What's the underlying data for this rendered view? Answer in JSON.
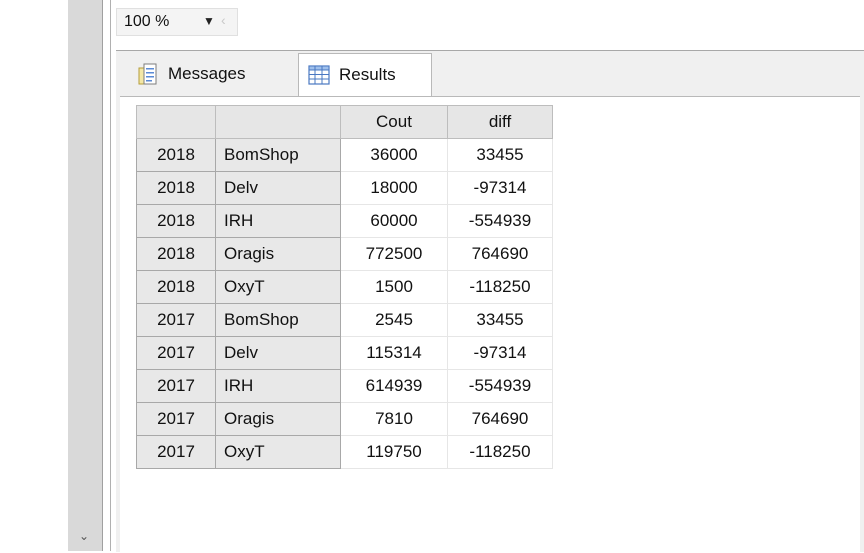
{
  "zoom": {
    "value": "100 %"
  },
  "tabs": [
    {
      "label": "Messages",
      "icon": "messages-icon"
    },
    {
      "label": "Results",
      "icon": "results-grid-icon"
    }
  ],
  "grid": {
    "headers": [
      "",
      "",
      "Cout",
      "diff"
    ],
    "rows": [
      {
        "year": "2018",
        "name": "BomShop",
        "cout": "36000",
        "diff": "33455"
      },
      {
        "year": "2018",
        "name": "Delv",
        "cout": "18000",
        "diff": "-97314"
      },
      {
        "year": "2018",
        "name": "IRH",
        "cout": "60000",
        "diff": "-554939"
      },
      {
        "year": "2018",
        "name": "Oragis",
        "cout": "772500",
        "diff": "764690"
      },
      {
        "year": "2018",
        "name": "OxyT",
        "cout": "1500",
        "diff": "-118250"
      },
      {
        "year": "2017",
        "name": "BomShop",
        "cout": "2545",
        "diff": "33455"
      },
      {
        "year": "2017",
        "name": "Delv",
        "cout": "115314",
        "diff": "-97314"
      },
      {
        "year": "2017",
        "name": "IRH",
        "cout": "614939",
        "diff": "-554939"
      },
      {
        "year": "2017",
        "name": "Oragis",
        "cout": "7810",
        "diff": "764690"
      },
      {
        "year": "2017",
        "name": "OxyT",
        "cout": "119750",
        "diff": "-118250"
      }
    ]
  },
  "colors": {
    "header_bg": "#e6e6e6",
    "row_header_bg": "#e8e8e8",
    "panel_bg": "#f0f0f0"
  }
}
